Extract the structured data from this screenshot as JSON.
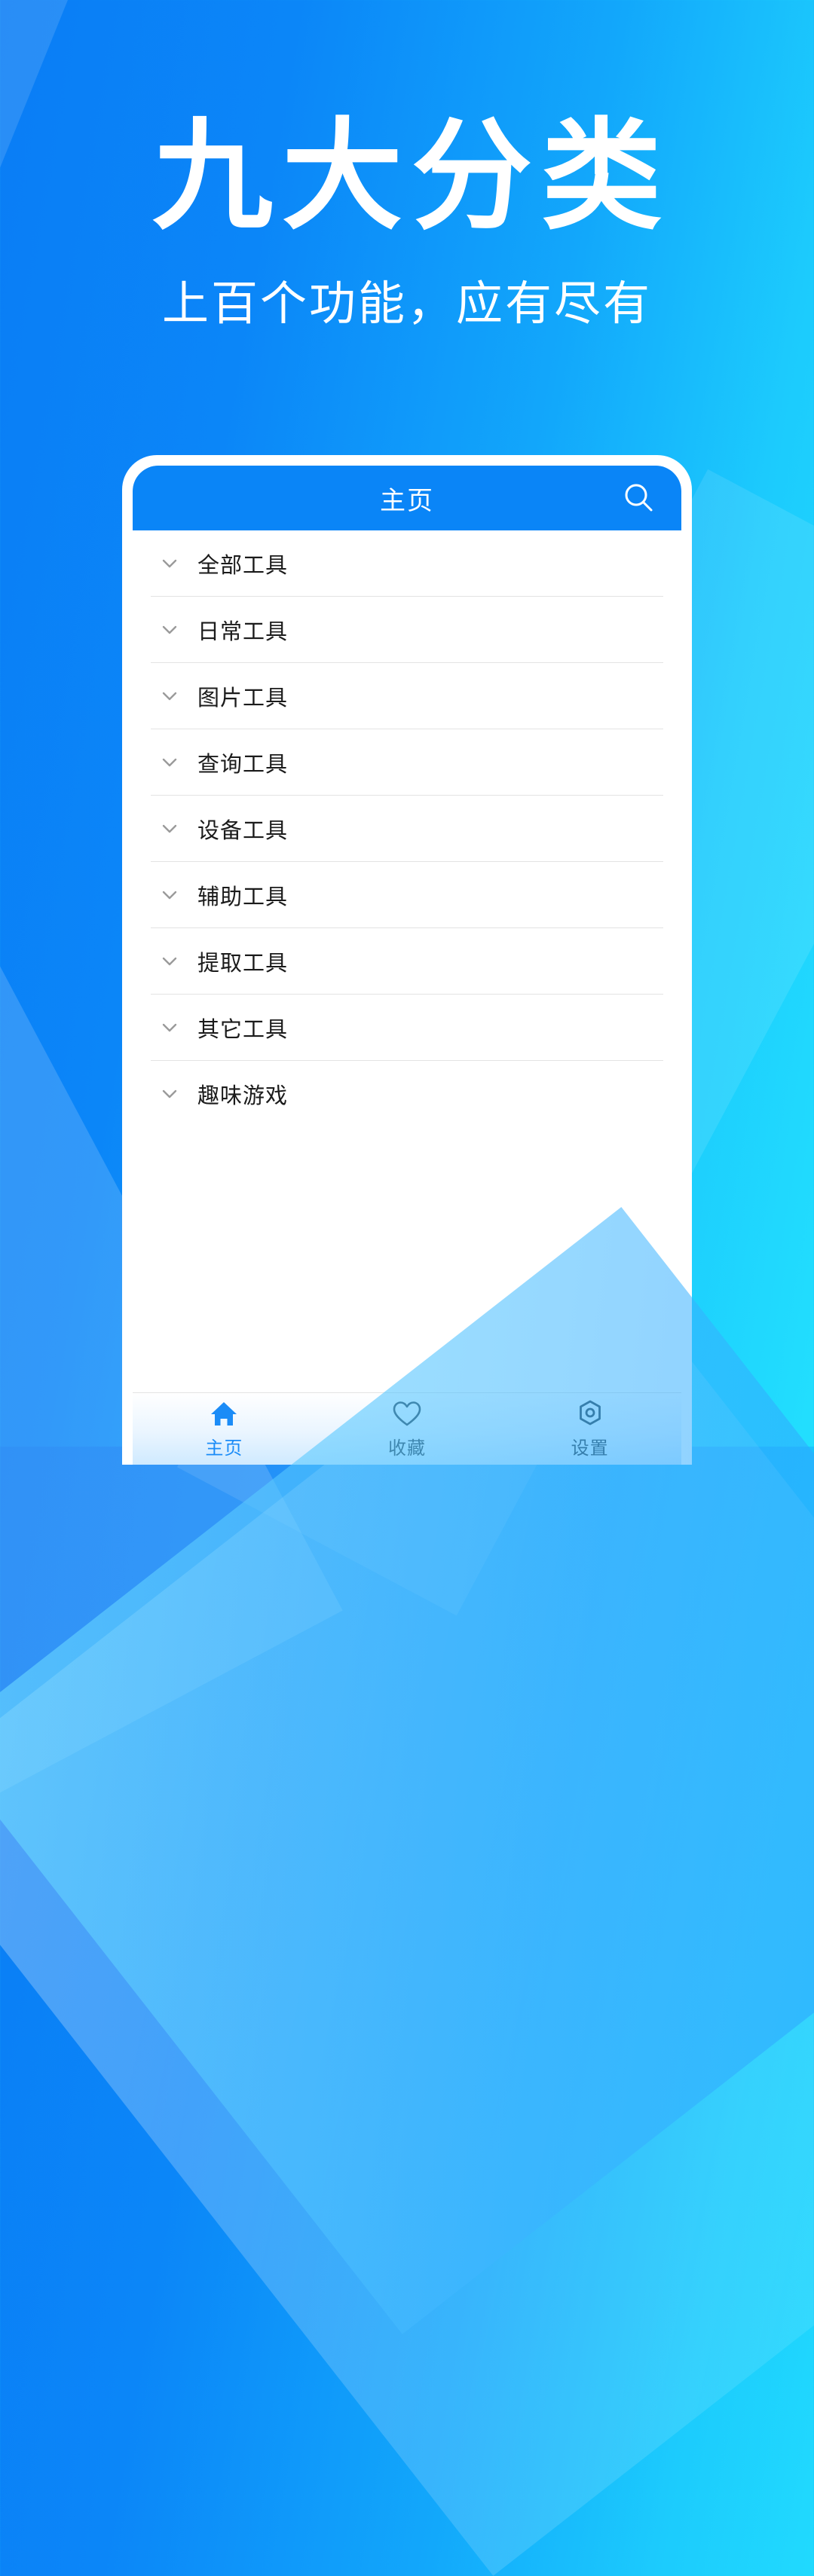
{
  "theme": {
    "bg_gradient_start": "#0a7df5",
    "bg_gradient_end": "#22dffe",
    "accent": "#0a85f7",
    "appbar_bg": "#0a85f7",
    "divider": "#e3e3e3",
    "text_primary": "#1b1b1b",
    "tab_active_color": "#1b8cf7",
    "tab_inactive_color": "#2b3a47"
  },
  "hero": {
    "title": "九大分类",
    "subtitle": "上百个功能，应有尽有"
  },
  "app": {
    "appbar": {
      "title": "主页",
      "search_icon": "search-icon"
    },
    "list": {
      "items": [
        {
          "label": "全部工具",
          "icon": "chevron-down-icon"
        },
        {
          "label": "日常工具",
          "icon": "chevron-down-icon"
        },
        {
          "label": "图片工具",
          "icon": "chevron-down-icon"
        },
        {
          "label": "查询工具",
          "icon": "chevron-down-icon"
        },
        {
          "label": "设备工具",
          "icon": "chevron-down-icon"
        },
        {
          "label": "辅助工具",
          "icon": "chevron-down-icon"
        },
        {
          "label": "提取工具",
          "icon": "chevron-down-icon"
        },
        {
          "label": "其它工具",
          "icon": "chevron-down-icon"
        },
        {
          "label": "趣味游戏",
          "icon": "chevron-down-icon"
        }
      ]
    },
    "tabbar": {
      "tabs": [
        {
          "label": "主页",
          "icon": "home-icon",
          "active": true
        },
        {
          "label": "收藏",
          "icon": "heart-icon",
          "active": false
        },
        {
          "label": "设置",
          "icon": "settings-gear-icon",
          "active": false
        }
      ]
    }
  }
}
